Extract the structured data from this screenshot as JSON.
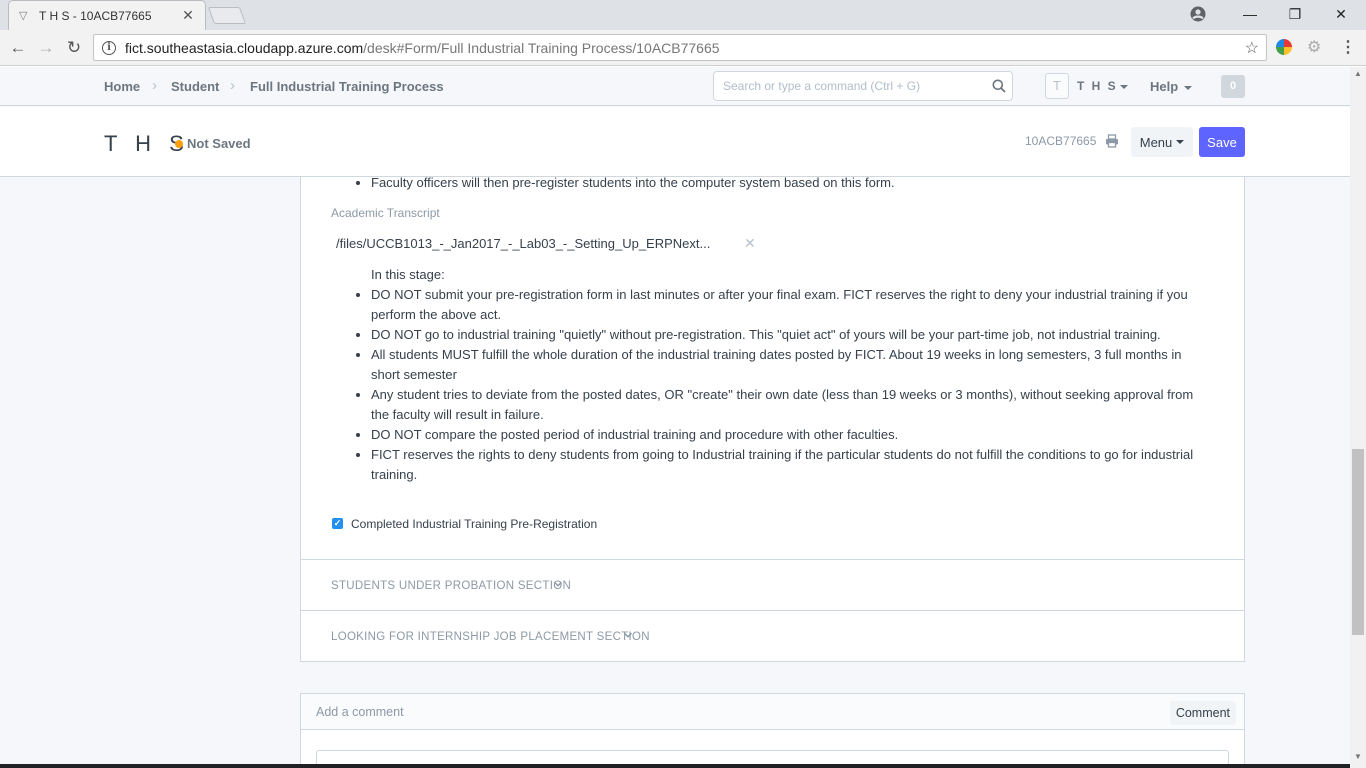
{
  "browser": {
    "tab_title": "T H S - 10ACB77665",
    "url_host": "fict.southeastasia.cloudapp.azure.com",
    "url_path": "/desk#Form/Full Industrial Training Process/10ACB77665"
  },
  "navbar": {
    "breadcrumbs": [
      "Home",
      "Student",
      "Full Industrial Training Process"
    ],
    "search_placeholder": "Search or type a command (Ctrl + G)",
    "user_initial": "T",
    "user_name": "T H S",
    "help_label": "Help",
    "notification_count": "0"
  },
  "page_head": {
    "title": "T H S",
    "status": "Not Saved",
    "doc_id": "10ACB77665",
    "menu_label": "Menu",
    "save_label": "Save"
  },
  "form": {
    "top_bullet": "Faculty officers will then pre-register students into the computer system based on this form.",
    "attachment_label": "Academic Transcript",
    "attachment_value": "/files/UCCB1013_-_Jan2017_-_Lab03_-_Setting_Up_ERPNext...",
    "stage_intro": "In this stage:",
    "stage_bullets": [
      "DO NOT submit your pre-registration form in last minutes or after your final exam. FICT reserves the right to deny your industrial training if you perform the above act.",
      "DO NOT go to industrial training \"quietly\" without pre-registration. This \"quiet act\" of yours will be your part-time job, not industrial training.",
      "All students MUST fulfill the whole duration of the industrial training dates posted by FICT. About 19 weeks in long semesters, 3 full months in short semester",
      "Any student tries to deviate from the posted dates, OR \"create\" their own date (less than 19 weeks or 3 months), without seeking approval from the faculty will result in failure.",
      "DO NOT compare the posted period of industrial training and procedure with other faculties.",
      "FICT reserves the rights to deny students from going to Industrial training if the particular students do not fulfill the conditions to go for industrial training."
    ],
    "checkbox_label": "Completed Industrial Training Pre-Registration",
    "checkbox_checked": true,
    "sections": [
      "STUDENTS UNDER PROBATION SECTION",
      "LOOKING FOR INTERNSHIP JOB PLACEMENT SECTION"
    ]
  },
  "comments": {
    "title": "Add a comment",
    "button_label": "Comment"
  },
  "colors": {
    "primary": "#5e64ff",
    "indicator_orange": "#ffa00a",
    "checkbox_blue": "#2490ef",
    "text_muted": "#8d99a6"
  }
}
